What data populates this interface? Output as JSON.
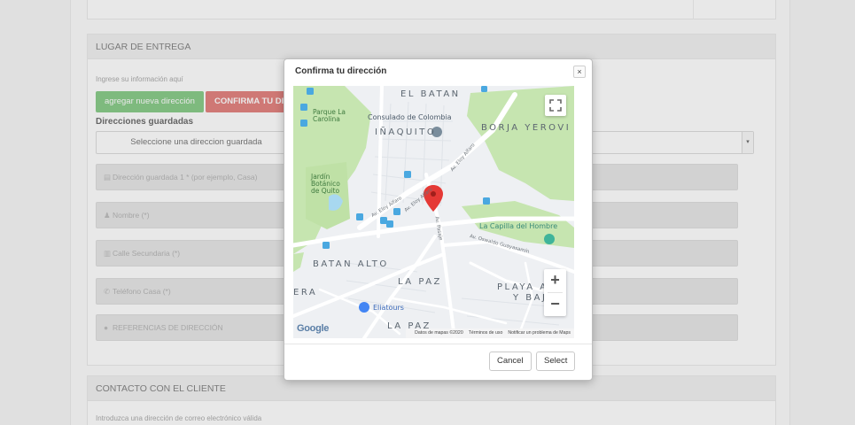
{
  "delivery": {
    "header": "LUGAR DE ENTREGA",
    "hint": "Ingrese su información aquí",
    "add_button": "agregar nueva dirección",
    "confirm_button": "CONFIRMA TU DIRECCIÓN",
    "saved_label": "Direcciones guardadas",
    "saved_select": "Seleccione una direccion guardada",
    "fields": [
      {
        "icon": "address-icon",
        "glyph": "▤",
        "placeholder": "Dirección guardada 1 * (por ejemplo, Casa)"
      },
      {
        "icon": "person-icon",
        "glyph": "♟",
        "placeholder": "Nombre (*)"
      },
      {
        "icon": "building-icon",
        "glyph": "▥",
        "placeholder": "Calle Secundaria (*)"
      },
      {
        "icon": "phone-icon",
        "glyph": "✆",
        "placeholder": "Teléfono Casa (*)"
      },
      {
        "icon": "pin-icon",
        "glyph": "●",
        "placeholder": "REFERENCIAS DE DIRECCIÓN"
      }
    ]
  },
  "contact": {
    "header": "CONTACTO CON EL CLIENTE",
    "hint": "Introduzca una dirección de correo electrónico válida"
  },
  "modal": {
    "title": "Confirma tu dirección",
    "close_glyph": "×",
    "cancel_label": "Cancel",
    "select_label": "Select"
  },
  "map": {
    "areas": [
      "EL BATAN",
      "IÑAQUITO",
      "BORJA YEROVI",
      "BATAN ALTO",
      "LA PAZ",
      "PLAYA A",
      "Y BAJ",
      "ERA",
      "LA PAZ"
    ],
    "pois": [
      "Parque La Carolina",
      "Consulado de Colombia",
      "Jardín Botánico de Quito",
      "La Capilla del Hombre",
      "Eliatours"
    ],
    "streets": [
      "Av. Eloy Alfaro",
      "Av. Eloy Alfaro",
      "Av. Oswaldo Guayasamín",
      "Av. Eloy Alfaro",
      "Av. Pasaje"
    ],
    "zoom_in": "+",
    "zoom_out": "−",
    "google": "Google",
    "attribution": {
      "data": "Datos de mapas ©2020",
      "terms": "Términos de uso",
      "report": "Notificar un problema de Maps"
    },
    "colors": {
      "park": "#c6e5b0",
      "water": "#a8d8f0",
      "marker": "#e53935",
      "road": "#ffffff",
      "land": "#eef0f3"
    }
  }
}
